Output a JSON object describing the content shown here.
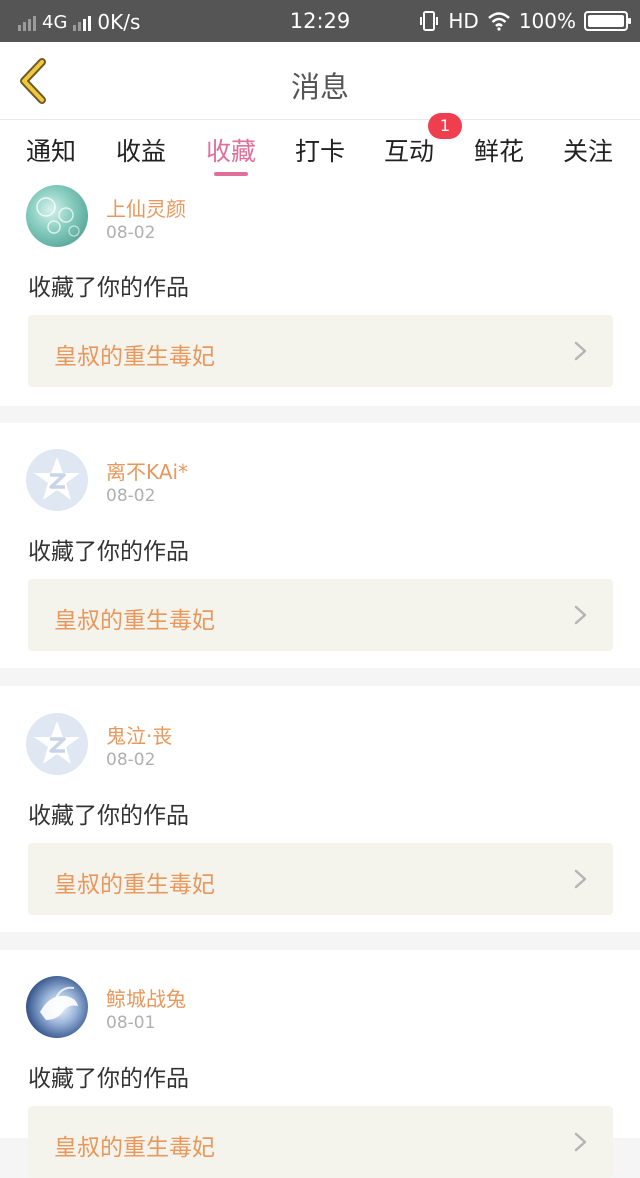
{
  "status_bar": {
    "network": "4G",
    "speed": "0K/s",
    "time": "12:29",
    "hd": "HD",
    "battery": "100%"
  },
  "header": {
    "title": "消息",
    "back_icon": "chevron-left-icon",
    "accent_color": "#e0709a"
  },
  "tabs": [
    {
      "label": "通知"
    },
    {
      "label": "收益"
    },
    {
      "label": "收藏",
      "active": true
    },
    {
      "label": "打卡"
    },
    {
      "label": "互动",
      "badge": "1"
    },
    {
      "label": "鲜花"
    },
    {
      "label": "关注"
    }
  ],
  "messages": [
    {
      "user": "上仙灵颜",
      "date": "08-02",
      "action": "收藏了你的作品",
      "work": "皇叔的重生毒妃",
      "avatar": "bubble-avatar"
    },
    {
      "user": "离不KAi*",
      "date": "08-02",
      "action": "收藏了你的作品",
      "work": "皇叔的重生毒妃",
      "avatar": "qq-avatar"
    },
    {
      "user": "鬼泣·丧",
      "date": "08-02",
      "action": "收藏了你的作品",
      "work": "皇叔的重生毒妃",
      "avatar": "qq-avatar"
    },
    {
      "user": "鲸城战兔",
      "date": "08-01",
      "action": "收藏了你的作品",
      "work": "皇叔的重生毒妃",
      "avatar": "dove-avatar"
    }
  ]
}
